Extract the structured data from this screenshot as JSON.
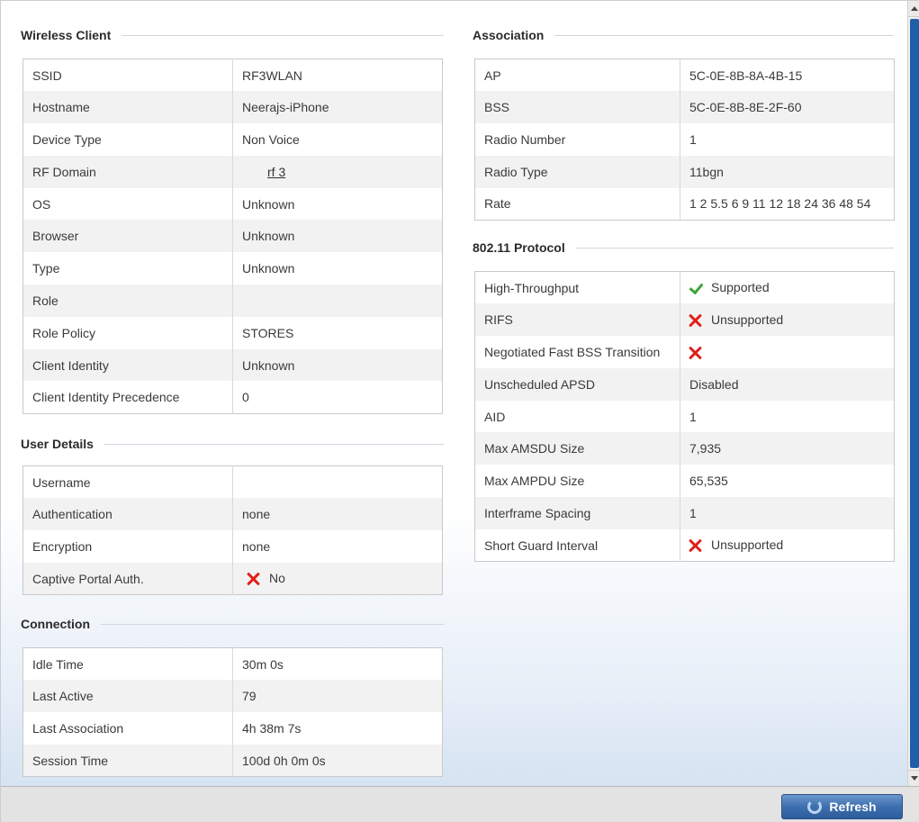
{
  "wireless_client": {
    "title": "Wireless Client",
    "rows": [
      {
        "label": "SSID",
        "value": "RF3WLAN"
      },
      {
        "label": "Hostname",
        "value": "Neerajs-iPhone"
      },
      {
        "label": "Device Type",
        "value": "Non Voice"
      },
      {
        "label": "RF Domain",
        "value": "rf 3"
      },
      {
        "label": "OS",
        "value": "Unknown"
      },
      {
        "label": "Browser",
        "value": "Unknown"
      },
      {
        "label": "Type",
        "value": "Unknown"
      },
      {
        "label": "Role",
        "value": ""
      },
      {
        "label": "Role Policy",
        "value": "STORES"
      },
      {
        "label": "Client Identity",
        "value": "Unknown"
      },
      {
        "label": "Client Identity Precedence",
        "value": "0"
      }
    ]
  },
  "user_details": {
    "title": "User Details",
    "rows": [
      {
        "label": "Username",
        "value": ""
      },
      {
        "label": "Authentication",
        "value": "none"
      },
      {
        "label": "Encryption",
        "value": "none"
      },
      {
        "label": "Captive Portal Auth.",
        "value": "No",
        "icon": "x-icon"
      }
    ]
  },
  "connection": {
    "title": "Connection",
    "rows": [
      {
        "label": "Idle Time",
        "value": "30m 0s"
      },
      {
        "label": "Last Active",
        "value": "79"
      },
      {
        "label": "Last Association",
        "value": "4h 38m 7s"
      },
      {
        "label": "Session Time",
        "value": "100d 0h 0m 0s"
      }
    ]
  },
  "association": {
    "title": "Association",
    "rows": [
      {
        "label": "AP",
        "value": "5C-0E-8B-8A-4B-15"
      },
      {
        "label": "BSS",
        "value": "5C-0E-8B-8E-2F-60"
      },
      {
        "label": "Radio Number",
        "value": "1"
      },
      {
        "label": "Radio Type",
        "value": "11bgn"
      },
      {
        "label": "Rate",
        "value": "1 2 5.5 6 9 11 12 18 24 36 48 54"
      }
    ]
  },
  "protocol": {
    "title": "802.11 Protocol",
    "rows": [
      {
        "label": "High-Throughput",
        "value": "Supported",
        "icon": "check-icon"
      },
      {
        "label": "RIFS",
        "value": "Unsupported",
        "icon": "x-icon"
      },
      {
        "label": "Negotiated Fast BSS Transition",
        "value": "",
        "icon": "x-icon"
      },
      {
        "label": "Unscheduled APSD",
        "value": "Disabled"
      },
      {
        "label": "AID",
        "value": "1"
      },
      {
        "label": "Max AMSDU Size",
        "value": "7,935"
      },
      {
        "label": "Max AMPDU Size",
        "value": "65,535"
      },
      {
        "label": "Interframe Spacing",
        "value": "1"
      },
      {
        "label": "Short Guard Interval",
        "value": "Unsupported",
        "icon": "x-icon"
      }
    ]
  },
  "footer": {
    "refresh_label": "Refresh"
  },
  "colors": {
    "error_red": "#e0201b",
    "success_green": "#3aa53a",
    "scroll_blue": "#1f5fa8",
    "button_blue": "#3e6fae"
  }
}
